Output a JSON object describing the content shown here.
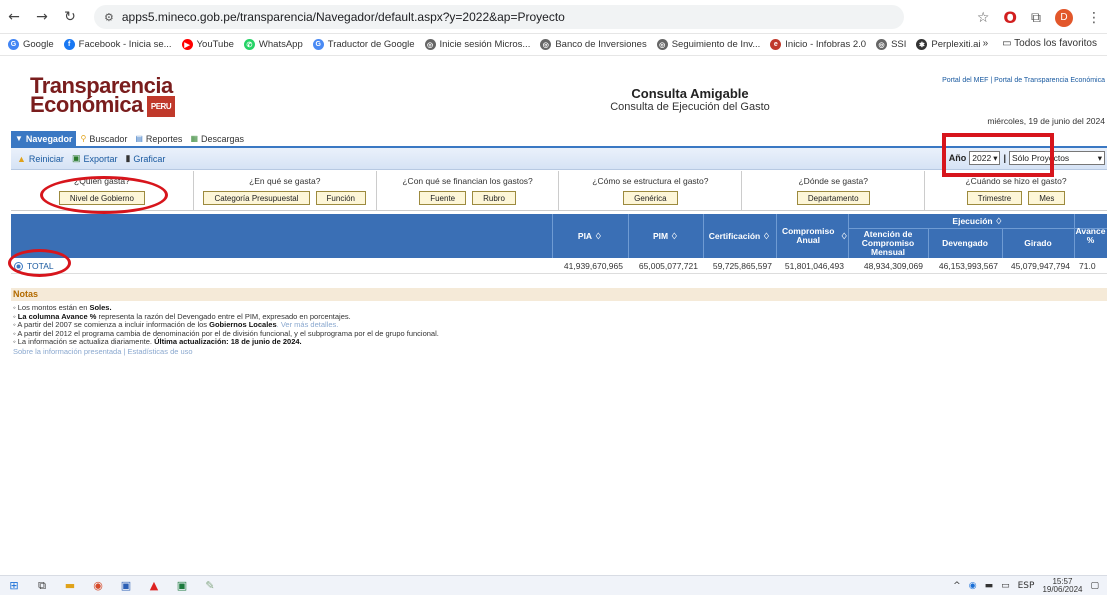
{
  "browser": {
    "url": "apps5.mineco.gob.pe/transparencia/Navegador/default.aspx?y=2022&ap=Proyecto",
    "profile_initial": "D",
    "bookmarks": [
      {
        "label": "Google",
        "color": "#4285f4",
        "glyph": "G"
      },
      {
        "label": "Facebook - Inicia se...",
        "color": "#1877f2",
        "glyph": "f"
      },
      {
        "label": "YouTube",
        "color": "#ff0000",
        "glyph": "▶"
      },
      {
        "label": "WhatsApp",
        "color": "#25d366",
        "glyph": "✆"
      },
      {
        "label": "Traductor de Google",
        "color": "#4a8af4",
        "glyph": "G"
      },
      {
        "label": "Inicie sesión Micros...",
        "color": "#666666",
        "glyph": "◎"
      },
      {
        "label": "Banco de Inversiones",
        "color": "#666666",
        "glyph": "◎"
      },
      {
        "label": "Seguimiento de Inv...",
        "color": "#666666",
        "glyph": "◎"
      },
      {
        "label": "Inicio - Infobras 2.0",
        "color": "#c0392b",
        "glyph": "e"
      },
      {
        "label": "SSI",
        "color": "#666666",
        "glyph": "◎"
      },
      {
        "label": "Perplexiti.ai",
        "color": "#333333",
        "glyph": "✱"
      }
    ],
    "more": "»",
    "all_favorites": "Todos los favoritos"
  },
  "header": {
    "logo_line1": "Transparencia",
    "logo_line2": "Económica",
    "logo_badge": "PERU",
    "title": "Consulta Amigable",
    "subtitle": "Consulta de Ejecución del Gasto",
    "top_links": "Portal del MEF  |  Portal de Transparencia Económica",
    "date": "miércoles, 19 de junio del 2024"
  },
  "tabs": [
    "Navegador",
    "Buscador",
    "Reportes",
    "Descargas"
  ],
  "toolbar": {
    "reiniciar": "Reiniciar",
    "exportar": "Exportar",
    "graficar": "Graficar",
    "anio_label": "Año",
    "anio_value": "2022",
    "proyecto_value": "Sólo Proyectos",
    "separator": "|"
  },
  "filters": [
    {
      "question": "¿Quién gasta?",
      "buttons": [
        "Nivel de Gobierno"
      ]
    },
    {
      "question": "¿En qué se gasta?",
      "buttons": [
        "Categoría Presupuestal",
        "Función"
      ]
    },
    {
      "question": "¿Con qué se financian los gastos?",
      "buttons": [
        "Fuente",
        "Rubro"
      ]
    },
    {
      "question": "¿Cómo se estructura el gasto?",
      "buttons": [
        "Genérica"
      ]
    },
    {
      "question": "¿Dónde se gasta?",
      "buttons": [
        "Departamento"
      ]
    },
    {
      "question": "¿Cuándo se hizo el gasto?",
      "buttons": [
        "Trimestre",
        "Mes"
      ]
    }
  ],
  "table": {
    "headers": {
      "pia": "PIA",
      "pim": "PIM",
      "cert": "Certificación",
      "comp_anual": "Compromiso Anual",
      "atencion": "Atención de Compromiso Mensual",
      "ejecucion": "Ejecución",
      "devengado": "Devengado",
      "girado": "Girado",
      "avance": "Avance %"
    },
    "total_row": {
      "label": "TOTAL",
      "pia": "41,939,670,965",
      "pim": "65,005,077,721",
      "cert": "59,725,865,597",
      "comp_anual": "51,801,046,493",
      "atencion": "48,934,309,069",
      "devengado": "46,153,993,567",
      "girado": "45,079,947,794",
      "avance": "71.0"
    }
  },
  "notes": {
    "heading": "Notas",
    "n1_a": "Los montos están en ",
    "n1_b": "Soles.",
    "n2_a": "La columna Avance %",
    "n2_b": " representa la razón del Devengado entre el PIM, expresado en porcentajes.",
    "n3_a": "A partir del 2007 se comienza a incluir información de los ",
    "n3_b": "Gobiernos Locales",
    "n3_c": ". Ver más detalles.",
    "n4": "A partir del 2012 el programa cambia de denominación por el de división funcional, y el subprograma por el de grupo funcional.",
    "n5_a": "La información se actualiza diariamente. ",
    "n5_b": "Última actualización: 18 de junio de 2024.",
    "footer_a": "Sobre la información presentada",
    "footer_sep": "|",
    "footer_b": "Estadísticas de uso"
  },
  "taskbar": {
    "lang": "ESP",
    "time": "15:57",
    "date": "19/06/2024"
  },
  "colors": {
    "header_blue": "#3a6fb5",
    "annotation_red": "#d7151c",
    "button_fill": "#fdf6d8"
  }
}
